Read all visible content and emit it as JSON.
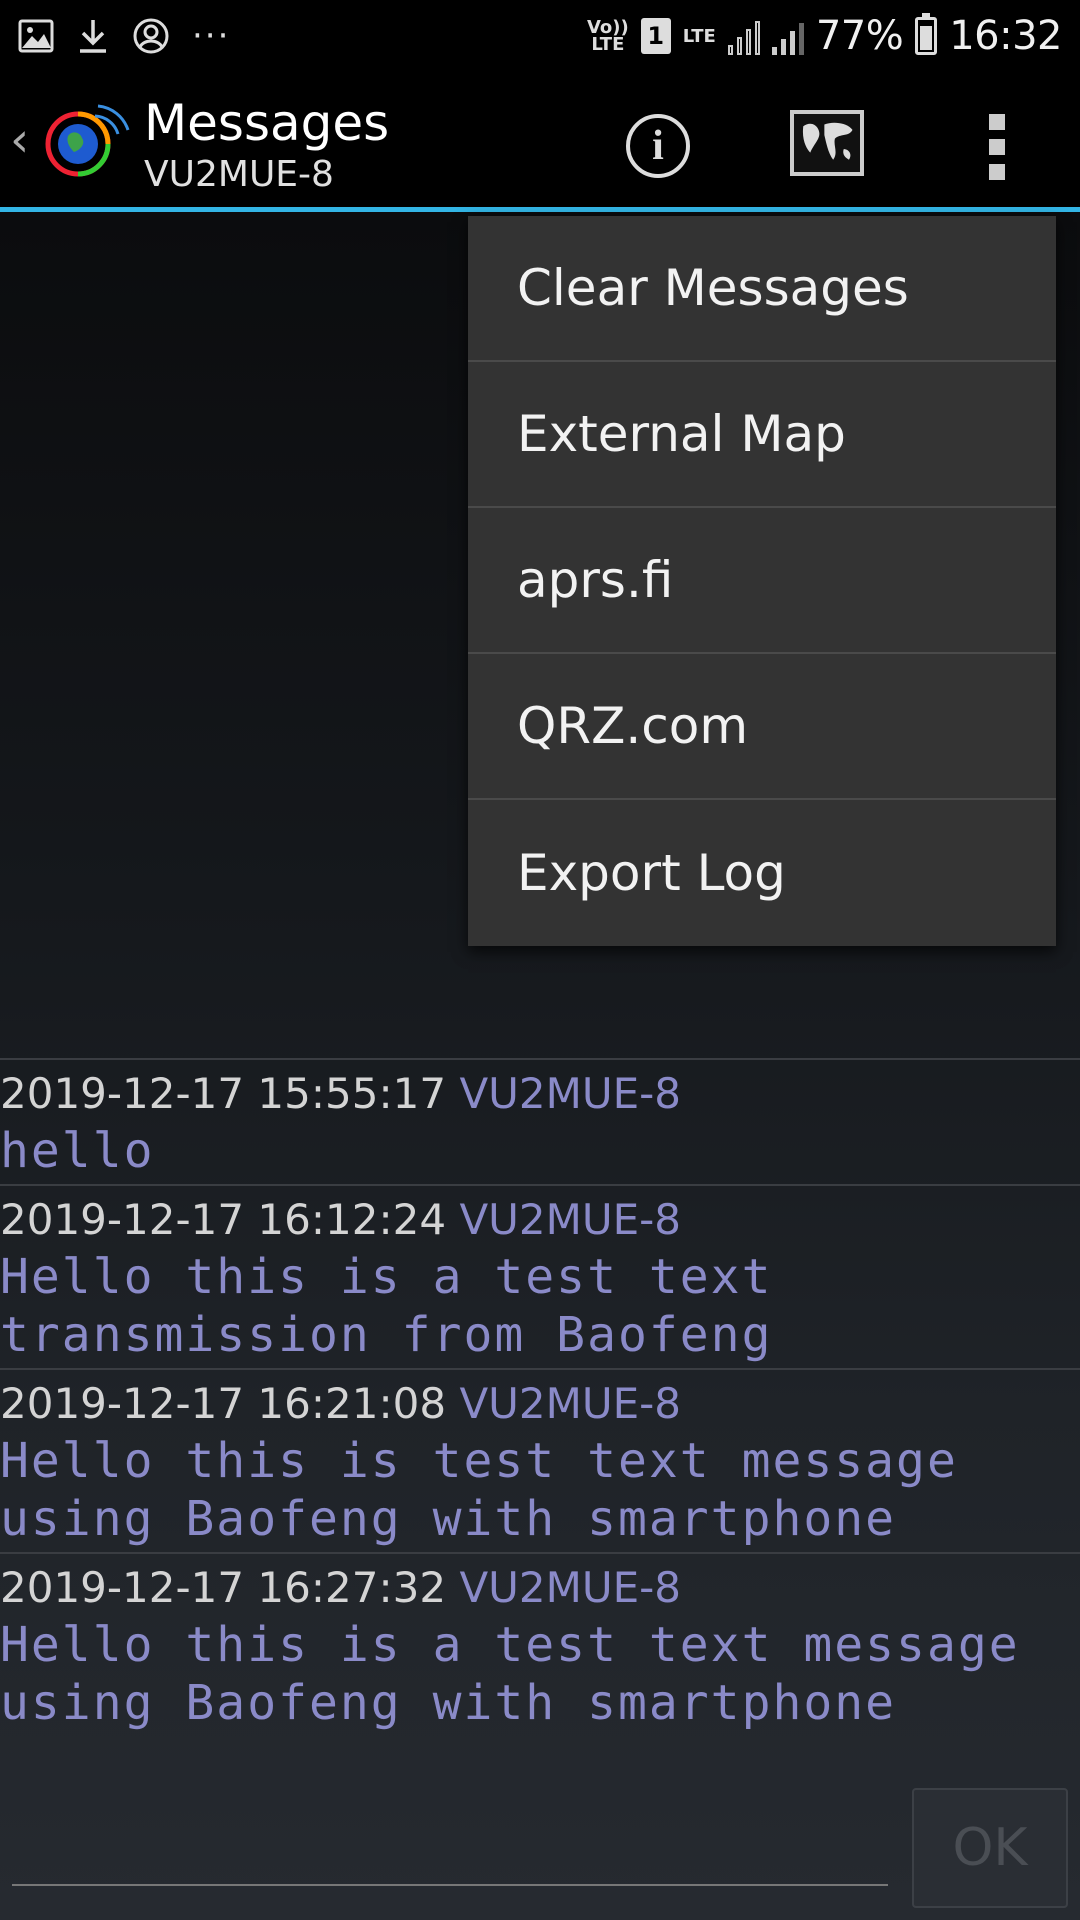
{
  "status_bar": {
    "volte": "Vo))\nLTE",
    "sim": "1",
    "lte": "LTE",
    "battery": "77%",
    "time": "16:32"
  },
  "app_bar": {
    "title": "Messages",
    "subtitle": "VU2MUE-8",
    "info_symbol": "i"
  },
  "menu": {
    "items": [
      {
        "label": "Clear Messages"
      },
      {
        "label": "External Map"
      },
      {
        "label": "aprs.fi"
      },
      {
        "label": "QRZ.com"
      },
      {
        "label": "Export Log"
      }
    ]
  },
  "messages": [
    {
      "timestamp": "2019-12-17 15:55:17",
      "sender": "VU2MUE-8",
      "body": "hello"
    },
    {
      "timestamp": "2019-12-17 16:12:24",
      "sender": "VU2MUE-8",
      "body": "Hello this is a test text\ntransmission from Baofeng"
    },
    {
      "timestamp": "2019-12-17 16:21:08",
      "sender": "VU2MUE-8",
      "body": "Hello this is test text message\nusing Baofeng with smartphone"
    },
    {
      "timestamp": "2019-12-17 16:27:32",
      "sender": "VU2MUE-8",
      "body": "Hello this is a test text message\nusing Baofeng with smartphone"
    }
  ],
  "compose": {
    "ok_label": "OK"
  },
  "colors": {
    "accent": "#33b5e5",
    "message_text": "#8a8ac8",
    "menu_bg": "#333333"
  }
}
